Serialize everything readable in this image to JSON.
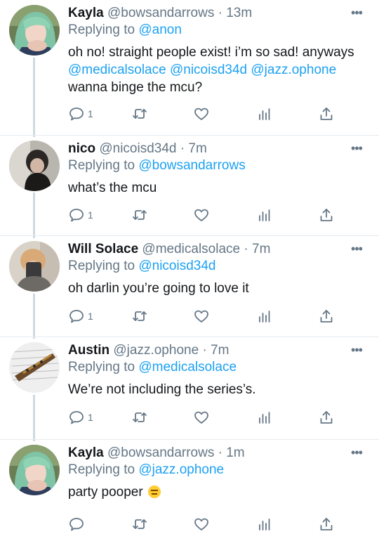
{
  "tweets": [
    {
      "name": "Kayla",
      "handle": "@bowsandarrows",
      "separator": "·",
      "time": "13m",
      "replying_prefix": "Replying to",
      "replying_to": "@anon",
      "text_parts": [
        {
          "t": "oh no! straight people exist! i’m so sad! anyways ",
          "link": false
        },
        {
          "t": "@medicalsolace",
          "link": true
        },
        {
          "t": " ",
          "link": false
        },
        {
          "t": "@nicoisd34d",
          "link": true
        },
        {
          "t": " ",
          "link": false
        },
        {
          "t": "@jazz.ophone",
          "link": true
        },
        {
          "t": " wanna binge the mcu?",
          "link": false
        }
      ],
      "reply_count": "1",
      "avatar": "avatar-kayla"
    },
    {
      "name": "nico",
      "handle": "@nicoisd34d",
      "separator": "·",
      "time": "7m",
      "replying_prefix": "Replying to",
      "replying_to": "@bowsandarrows",
      "text_parts": [
        {
          "t": "what’s the mcu",
          "link": false
        }
      ],
      "reply_count": "1",
      "avatar": "avatar-nico"
    },
    {
      "name": "Will Solace",
      "handle": "@medicalsolace",
      "separator": "·",
      "time": "7m",
      "replying_prefix": "Replying to",
      "replying_to": "@nicoisd34d",
      "text_parts": [
        {
          "t": "oh darlin you’re going to love it",
          "link": false
        }
      ],
      "reply_count": "1",
      "avatar": "avatar-will"
    },
    {
      "name": "Austin",
      "handle": "@jazz.ophone",
      "separator": "·",
      "time": "7m",
      "replying_prefix": "Replying to",
      "replying_to": "@medicalsolace",
      "text_parts": [
        {
          "t": "We’re not including the series’s.",
          "link": false
        }
      ],
      "reply_count": "1",
      "avatar": "avatar-austin"
    },
    {
      "name": "Kayla",
      "handle": "@bowsandarrows",
      "separator": "·",
      "time": "1m",
      "replying_prefix": "Replying to",
      "replying_to": "@jazz.ophone",
      "text_parts": [
        {
          "t": "party pooper ",
          "link": false
        }
      ],
      "emoji": "expressionless-face-emoji",
      "reply_count": "",
      "avatar": "avatar-kayla"
    }
  ],
  "icons": {
    "more": "more-horizontal-icon",
    "reply": "reply-icon",
    "retweet": "retweet-icon",
    "like": "heart-icon",
    "analytics": "analytics-icon",
    "share": "share-icon"
  },
  "colors": {
    "link": "#1da1f2",
    "secondary_text": "#657786",
    "thread_line": "#cfd9de",
    "divider": "#e6ecf0"
  }
}
